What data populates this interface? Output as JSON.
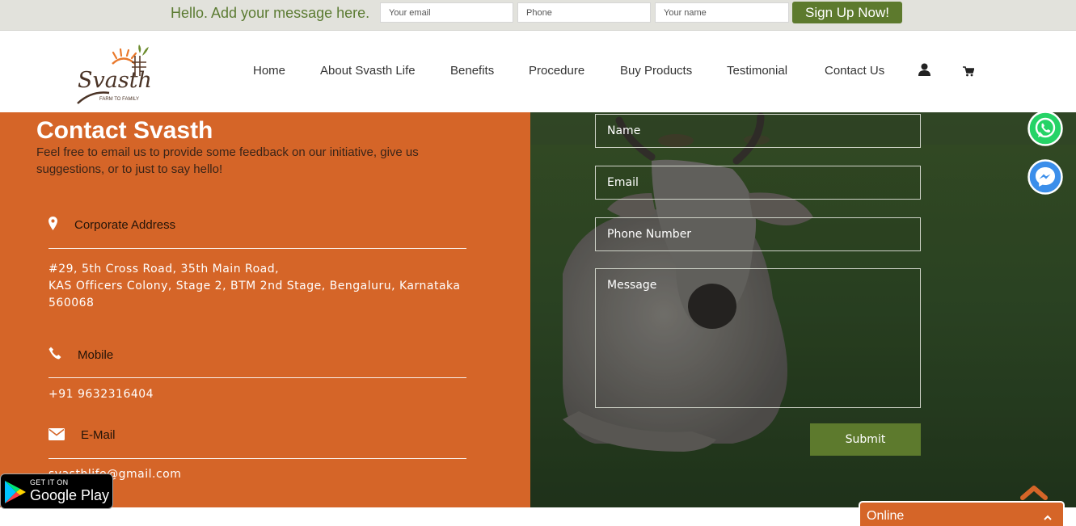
{
  "signup_bar": {
    "message": "Hello. Add your message here.",
    "email_placeholder": "Your email",
    "phone_placeholder": "Phone",
    "name_placeholder": "Your name",
    "button_label": "Sign Up Now!"
  },
  "header": {
    "logo": {
      "wordmark": "Svasth",
      "tagline": "FARM TO FAMILY"
    },
    "nav": [
      {
        "label": "Home"
      },
      {
        "label": "About Svasth Life"
      },
      {
        "label": "Benefits"
      },
      {
        "label": "Procedure"
      },
      {
        "label": "Buy Products"
      },
      {
        "label": "Testimonial"
      },
      {
        "label": "Contact Us"
      }
    ],
    "icons": [
      "user-icon",
      "cart-icon"
    ]
  },
  "contact": {
    "title": "Contact Svasth",
    "description": "Feel free to email us to provide some feedback on our initiative, give us suggestions, or to just to say hello!",
    "address": {
      "heading": "Corporate Address",
      "lines": [
        "#29, 5th Cross Road, 35th Main Road,",
        "KAS Officers Colony, Stage 2, BTM 2nd Stage, Bengaluru, Karnataka",
        "560068"
      ]
    },
    "mobile": {
      "heading": "Mobile",
      "value": "+91 9632316404"
    },
    "email": {
      "heading": "E-Mail",
      "value": "svasthlife@gmail.com"
    }
  },
  "form": {
    "name_placeholder": "Name",
    "email_placeholder": "Email",
    "phone_placeholder": "Phone Number",
    "message_placeholder": "Message",
    "submit_label": "Submit"
  },
  "widgets": {
    "google_play_small": "GET IT ON",
    "google_play_big": "Google Play",
    "chat_status": "Online"
  },
  "colors": {
    "brand_green": "#5d7a2d",
    "contact_orange": "#d56528",
    "whatsapp_green": "#25d366",
    "messenger_blue": "#3b8eea"
  }
}
